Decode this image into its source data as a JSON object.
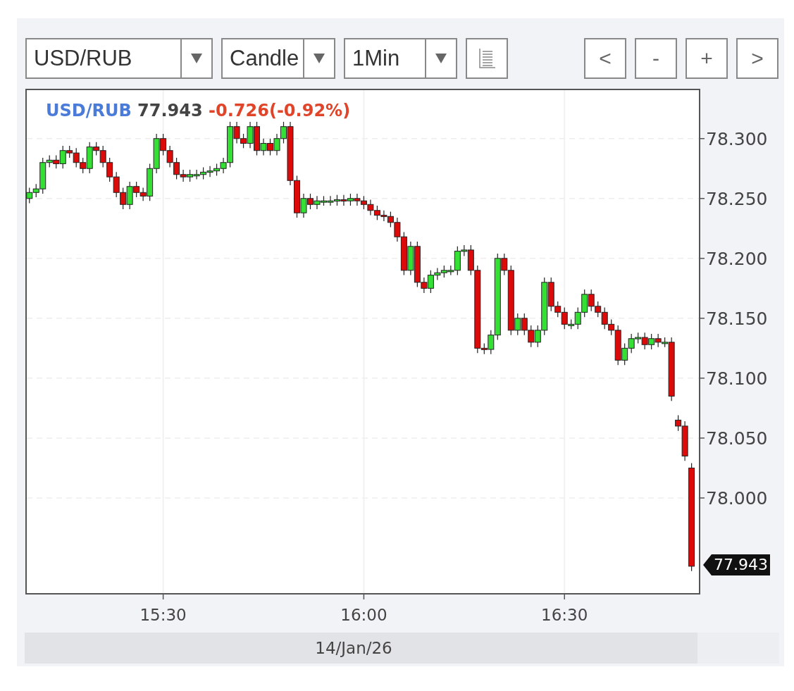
{
  "toolbar": {
    "selects": [
      {
        "value": "USD/RUB"
      },
      {
        "value": "Candle"
      },
      {
        "value": "1Min"
      }
    ],
    "nav_buttons": [
      "<",
      "-",
      "+",
      ">"
    ]
  },
  "chart": {
    "legend": {
      "symbol": "USD/RUB",
      "price": "77.943",
      "change": "-0.726(-0.92%)"
    },
    "last_price_tag": "77.943",
    "date": "14/Jan/26",
    "chart_data": {
      "type": "candlestick",
      "x": [
        910,
        911,
        912,
        913,
        914,
        915,
        916,
        917,
        918,
        919,
        920,
        921,
        922,
        923,
        924,
        925,
        926,
        927,
        928,
        929,
        930,
        931,
        932,
        933,
        934,
        935,
        936,
        937,
        938,
        939,
        940,
        941,
        942,
        943,
        944,
        945,
        946,
        947,
        948,
        949,
        950,
        951,
        952,
        953,
        954,
        955,
        956,
        957,
        958,
        959,
        960,
        961,
        962,
        963,
        964,
        965,
        966,
        967,
        968,
        969,
        970,
        971,
        972,
        973,
        974,
        975,
        976,
        977,
        978,
        979,
        980,
        981,
        982,
        983,
        984,
        985,
        986,
        987,
        988,
        989,
        990,
        991,
        992,
        993,
        994,
        995,
        996,
        997,
        998,
        999,
        1000,
        1001,
        1002,
        1003,
        1004,
        1005,
        1006,
        1007,
        1008,
        1009
      ],
      "xlim": [
        909.5,
        1010.2
      ],
      "ylim": [
        77.92,
        78.341
      ],
      "grid": true,
      "ohlc": [
        [
          78.25,
          78.259,
          78.246,
          78.255
        ],
        [
          78.255,
          78.262,
          78.251,
          78.258
        ],
        [
          78.258,
          78.284,
          78.254,
          78.28
        ],
        [
          78.28,
          78.286,
          78.276,
          78.282
        ],
        [
          78.282,
          78.286,
          78.275,
          78.279
        ],
        [
          78.279,
          78.294,
          78.275,
          78.29
        ],
        [
          78.29,
          78.294,
          78.284,
          78.288
        ],
        [
          78.288,
          78.292,
          78.276,
          78.28
        ],
        [
          78.28,
          78.284,
          78.271,
          78.275
        ],
        [
          78.275,
          78.297,
          78.271,
          78.293
        ],
        [
          78.293,
          78.297,
          78.286,
          78.29
        ],
        [
          78.29,
          78.294,
          78.276,
          78.28
        ],
        [
          78.28,
          78.284,
          78.264,
          78.268
        ],
        [
          78.268,
          78.272,
          78.251,
          78.255
        ],
        [
          78.255,
          78.259,
          78.241,
          78.245
        ],
        [
          78.245,
          78.264,
          78.241,
          78.26
        ],
        [
          78.26,
          78.264,
          78.251,
          78.255
        ],
        [
          78.255,
          78.259,
          78.248,
          78.252
        ],
        [
          78.252,
          78.279,
          78.248,
          78.275
        ],
        [
          78.275,
          78.304,
          78.271,
          78.3
        ],
        [
          78.3,
          78.304,
          78.286,
          78.29
        ],
        [
          78.29,
          78.294,
          78.276,
          78.28
        ],
        [
          78.28,
          78.284,
          78.266,
          78.27
        ],
        [
          78.27,
          78.274,
          78.264,
          78.268
        ],
        [
          78.268,
          78.274,
          78.264,
          78.27
        ],
        [
          78.27,
          78.274,
          78.266,
          78.27
        ],
        [
          78.27,
          78.276,
          78.266,
          78.272
        ],
        [
          78.272,
          78.277,
          78.268,
          78.273
        ],
        [
          78.273,
          78.279,
          78.269,
          78.275
        ],
        [
          78.275,
          78.284,
          78.271,
          78.28
        ],
        [
          78.28,
          78.314,
          78.276,
          78.31
        ],
        [
          78.31,
          78.314,
          78.296,
          78.3
        ],
        [
          78.3,
          78.304,
          78.292,
          78.296
        ],
        [
          78.296,
          78.314,
          78.292,
          78.31
        ],
        [
          78.31,
          78.314,
          78.286,
          78.29
        ],
        [
          78.29,
          78.3,
          78.286,
          78.296
        ],
        [
          78.296,
          78.3,
          78.286,
          78.29
        ],
        [
          78.29,
          78.304,
          78.286,
          78.3
        ],
        [
          78.3,
          78.314,
          78.296,
          78.31
        ],
        [
          78.31,
          78.314,
          78.261,
          78.265
        ],
        [
          78.265,
          78.269,
          78.234,
          78.238
        ],
        [
          78.238,
          78.254,
          78.234,
          78.25
        ],
        [
          78.25,
          78.254,
          78.241,
          78.245
        ],
        [
          78.245,
          78.252,
          78.241,
          78.248
        ],
        [
          78.248,
          78.252,
          78.244,
          78.248
        ],
        [
          78.248,
          78.252,
          78.244,
          78.248
        ],
        [
          78.248,
          78.253,
          78.244,
          78.249
        ],
        [
          78.249,
          78.253,
          78.244,
          78.248
        ],
        [
          78.248,
          78.254,
          78.244,
          78.25
        ],
        [
          78.25,
          78.254,
          78.244,
          78.248
        ],
        [
          78.248,
          78.252,
          78.241,
          78.245
        ],
        [
          78.245,
          78.249,
          78.236,
          78.24
        ],
        [
          78.24,
          78.244,
          78.232,
          78.236
        ],
        [
          78.236,
          78.24,
          78.231,
          78.235
        ],
        [
          78.235,
          78.239,
          78.226,
          78.23
        ],
        [
          78.23,
          78.234,
          78.214,
          78.218
        ],
        [
          78.218,
          78.222,
          78.186,
          78.19
        ],
        [
          78.19,
          78.214,
          78.186,
          78.21
        ],
        [
          78.21,
          78.214,
          78.176,
          78.18
        ],
        [
          78.18,
          78.184,
          78.171,
          78.175
        ],
        [
          78.175,
          78.19,
          78.171,
          78.186
        ],
        [
          78.186,
          78.192,
          78.182,
          78.188
        ],
        [
          78.188,
          78.194,
          78.184,
          78.19
        ],
        [
          78.19,
          78.194,
          78.186,
          78.19
        ],
        [
          78.19,
          78.21,
          78.186,
          78.206
        ],
        [
          78.206,
          78.211,
          78.202,
          78.207
        ],
        [
          78.207,
          78.211,
          78.186,
          78.19
        ],
        [
          78.19,
          78.194,
          78.121,
          78.125
        ],
        [
          78.125,
          78.129,
          78.12,
          78.124
        ],
        [
          78.124,
          78.14,
          78.12,
          78.136
        ],
        [
          78.136,
          78.204,
          78.132,
          78.2
        ],
        [
          78.2,
          78.204,
          78.186,
          78.19
        ],
        [
          78.19,
          78.194,
          78.136,
          78.14
        ],
        [
          78.14,
          78.154,
          78.136,
          78.15
        ],
        [
          78.15,
          78.154,
          78.136,
          78.14
        ],
        [
          78.14,
          78.144,
          78.126,
          78.13
        ],
        [
          78.13,
          78.144,
          78.126,
          78.14
        ],
        [
          78.14,
          78.184,
          78.136,
          78.18
        ],
        [
          78.18,
          78.184,
          78.156,
          78.16
        ],
        [
          78.16,
          78.164,
          78.151,
          78.155
        ],
        [
          78.155,
          78.159,
          78.141,
          78.145
        ],
        [
          78.145,
          78.149,
          78.141,
          78.145
        ],
        [
          78.145,
          78.159,
          78.141,
          78.155
        ],
        [
          78.155,
          78.174,
          78.151,
          78.17
        ],
        [
          78.17,
          78.174,
          78.156,
          78.16
        ],
        [
          78.16,
          78.164,
          78.151,
          78.155
        ],
        [
          78.155,
          78.159,
          78.141,
          78.145
        ],
        [
          78.145,
          78.149,
          78.136,
          78.14
        ],
        [
          78.14,
          78.144,
          78.111,
          78.115
        ],
        [
          78.115,
          78.129,
          78.111,
          78.125
        ],
        [
          78.125,
          78.137,
          78.121,
          78.133
        ],
        [
          78.133,
          78.138,
          78.129,
          78.134
        ],
        [
          78.134,
          78.138,
          78.124,
          78.128
        ],
        [
          78.128,
          78.137,
          78.124,
          78.133
        ],
        [
          78.133,
          78.137,
          78.126,
          78.13
        ],
        [
          78.13,
          78.134,
          78.126,
          78.13
        ],
        [
          78.13,
          78.134,
          78.081,
          78.085
        ],
        [
          78.065,
          78.069,
          78.056,
          78.06
        ],
        [
          78.06,
          78.064,
          78.031,
          78.035
        ],
        [
          78.025,
          78.029,
          77.939,
          77.943
        ]
      ],
      "xticks": [
        {
          "value": 930,
          "label": "15:30"
        },
        {
          "value": 960,
          "label": "16:00"
        },
        {
          "value": 990,
          "label": "16:30"
        }
      ],
      "yticks": [
        {
          "value": 78.3,
          "label": "78.300"
        },
        {
          "value": 78.25,
          "label": "78.250"
        },
        {
          "value": 78.2,
          "label": "78.200"
        },
        {
          "value": 78.15,
          "label": "78.150"
        },
        {
          "value": 78.1,
          "label": "78.100"
        },
        {
          "value": 78.05,
          "label": "78.050"
        },
        {
          "value": 78.0,
          "label": "78.000"
        }
      ]
    }
  }
}
